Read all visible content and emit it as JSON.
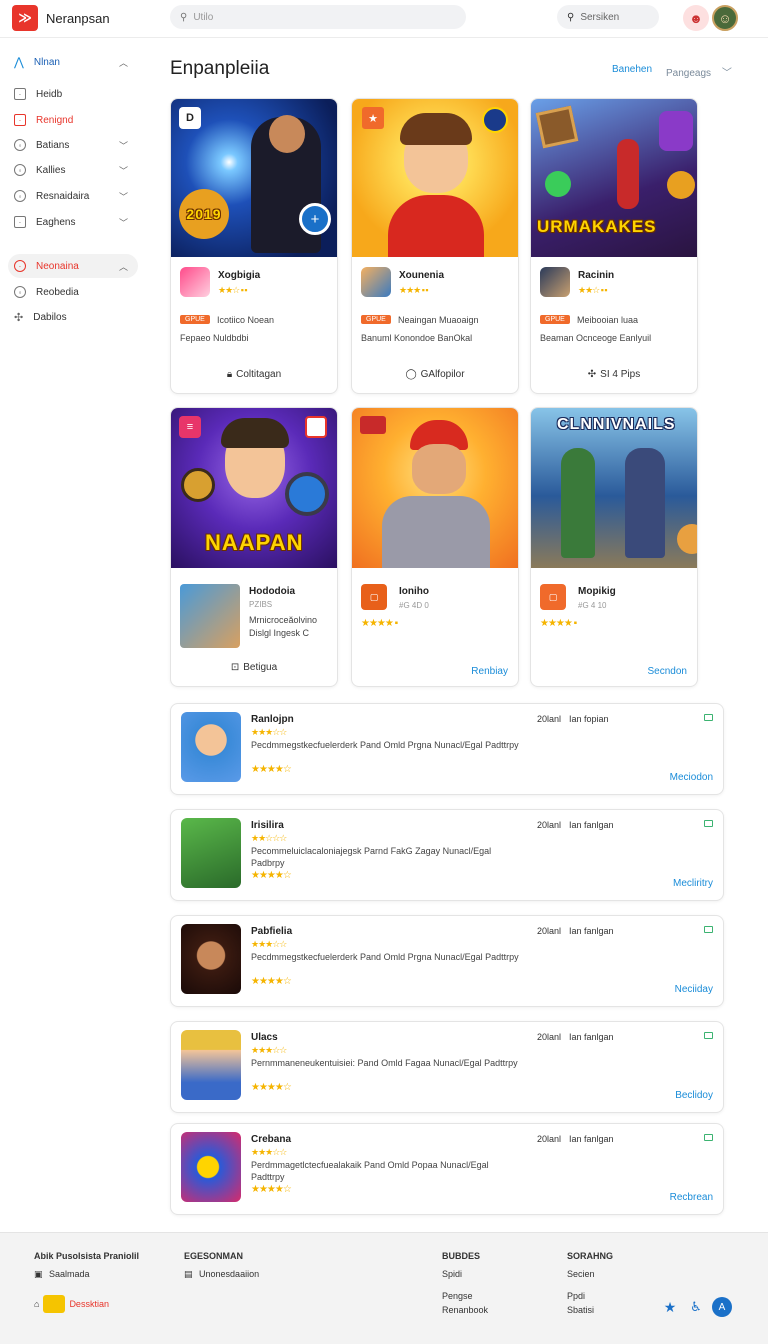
{
  "header": {
    "brand": "Neranpsan",
    "search_placeholder": "Utilo",
    "search2_label": "Sersiken"
  },
  "sidebar": {
    "items": [
      {
        "label": "Nlnan"
      },
      {
        "label": "Heidb"
      },
      {
        "label": "Renignd"
      },
      {
        "label": "Batians"
      },
      {
        "label": "Kallies"
      },
      {
        "label": "Resnaidaira"
      },
      {
        "label": "Eaghens"
      },
      {
        "label": "Neonaina"
      },
      {
        "label": "Reobedia"
      },
      {
        "label": "Dabilos"
      }
    ]
  },
  "main": {
    "title": "Enpanpleiia",
    "sort_primary": "Banehen",
    "sort_secondary": "Pangeags"
  },
  "featured": [
    {
      "name": "Xogbigia",
      "badge": "GPUE",
      "desc1": "Icotiico Noean",
      "desc2": "Fepaeo  Nuldbdbi",
      "action": "Coltitagan",
      "hero_text": "2019",
      "hero_colors": [
        "#0b1e5a",
        "#2a5ac8"
      ]
    },
    {
      "name": "Xounenia",
      "badge": "GPUE",
      "desc1": "Neaingan Muaoaign",
      "desc2": "Banuml  Konondoe  BanOkal",
      "action": "GAlfopilor",
      "hero_text": "",
      "hero_colors": [
        "#f7a81b",
        "#ffdd55"
      ]
    },
    {
      "name": "Racinin",
      "badge": "GPUE",
      "desc1": "Meibooian luaa",
      "desc2": "Beaman  Ocnceoge  Eanlyuil",
      "action": "SI 4 Pips",
      "hero_text": "URMAKAKES",
      "hero_colors": [
        "#3a1f6b",
        "#6aa0e8"
      ]
    }
  ],
  "cards2": [
    {
      "name": "Hododoia",
      "sub": "PZIBS",
      "desc": "Mrnicroceăolvino Dislgl Ingesk C",
      "action": "Betigua",
      "hero_text": "NAAPAN",
      "hero_colors": [
        "#3a1a7a",
        "#7a4ad8"
      ]
    },
    {
      "name": "Ioniho",
      "sub": "#G 4D 0",
      "link": "Renbiay",
      "hero_text": "",
      "hero_colors": [
        "#f07020",
        "#ffcc40"
      ]
    },
    {
      "name": "Mopikig",
      "sub": "#G 4 10",
      "link": "Secndon",
      "hero_text": "CLNNIVNAILS",
      "hero_colors": [
        "#1a3a6a",
        "#88c4e8"
      ]
    }
  ],
  "list": [
    {
      "name": "Ranlojpn",
      "desc": "Pecdmmegstkecfuelerderk Pand Omld Prgna Nunacl/Egal Padttrpy",
      "meta1": "20lanl",
      "meta2": "Ian fopian",
      "link": "Meciodon"
    },
    {
      "name": "Irisilira",
      "desc": "Pecommeluiclacaloniajegsk Parnd FakG Zagay Nunacl/Egal Padbrpy",
      "meta1": "20lanl",
      "meta2": "Ian fanlgan",
      "link": "Mecliritry"
    },
    {
      "name": "Pabfielia",
      "desc": "Pecdmmegstkecfuelerderk Pand Omld Prgna Nunacl/Egal Padttrpy",
      "meta1": "20lanl",
      "meta2": "Ian fanlgan",
      "link": "Neciiday"
    },
    {
      "name": "Ulacs",
      "desc": "Pernmmaneneukentuisiei: Pand Omld Fagaa Nunacl/Egal Padttrpy",
      "meta1": "20lanl",
      "meta2": "Ian fanlgan",
      "link": "Beclidoy"
    },
    {
      "name": "Crebana",
      "desc": "Perdmmagetlctecfuealakaik Pand Omld Popaa Nunacl/Egal Padttrpy",
      "meta1": "20lanl",
      "meta2": "Ian fanlgan",
      "link": "Recbrean"
    }
  ],
  "footer": {
    "col1_title": "Abik Pusolsista Praniolil",
    "col1_item": "Saalmada",
    "col1_button": "Dessktian",
    "col2_title": "EGESONMAN",
    "col2_item": "Unonesdaaiion",
    "col3_title": "BUBDES",
    "col3_items": [
      "Spidi",
      "Pengse",
      "Renanbook"
    ],
    "col4_title": "SORAHNG",
    "col4_items": [
      "Secien",
      "Ppdi",
      "Sbatisi"
    ]
  },
  "colors": {
    "accent": "#e8352b",
    "link": "#1a8cd8",
    "star": "#f5b400",
    "badge": "#f06a2b"
  },
  "icons": {
    "logo": "brand-logo-icon",
    "search": "search-icon",
    "chevron": "chevron-icon"
  }
}
